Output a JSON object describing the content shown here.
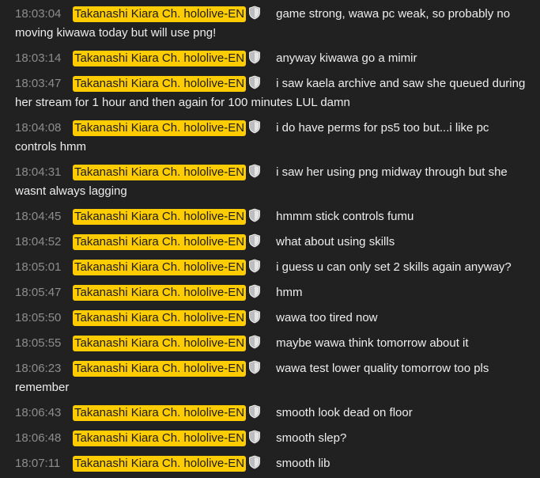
{
  "author_name": "Takanashi Kiara Ch. hololive-EN",
  "badge_icon": "moderator-shield-icon",
  "colors": {
    "background": "#212121",
    "author_highlight": "#ffcc00",
    "timestamp": "#8d8d8d",
    "text": "#ededed"
  },
  "messages": [
    {
      "time": "18:03:04",
      "text": "game strong, wawa pc weak, so probably no moving kiwawa today but will use png!"
    },
    {
      "time": "18:03:14",
      "text": "anyway kiwawa go a mimir"
    },
    {
      "time": "18:03:47",
      "text": "i saw kaela archive and saw she queued during her stream for 1 hour and then again for 100 minutes LUL damn"
    },
    {
      "time": "18:04:08",
      "text": "i do have perms for ps5 too but...i like pc controls hmm"
    },
    {
      "time": "18:04:31",
      "text": "i saw her using png midway through but she wasnt always lagging"
    },
    {
      "time": "18:04:45",
      "text": "hmmm stick controls fumu"
    },
    {
      "time": "18:04:52",
      "text": "what about using skills"
    },
    {
      "time": "18:05:01",
      "text": "i guess u can only set 2 skills again anyway?"
    },
    {
      "time": "18:05:47",
      "text": "hmm"
    },
    {
      "time": "18:05:50",
      "text": "wawa too tired now"
    },
    {
      "time": "18:05:55",
      "text": "maybe wawa think tomorrow about it"
    },
    {
      "time": "18:06:23",
      "text": "wawa test lower quality tomorrow too pls remember"
    },
    {
      "time": "18:06:43",
      "text": "smooth look dead on floor"
    },
    {
      "time": "18:06:48",
      "text": "smooth slep?"
    },
    {
      "time": "18:07:11",
      "text": "smooth lib"
    }
  ]
}
